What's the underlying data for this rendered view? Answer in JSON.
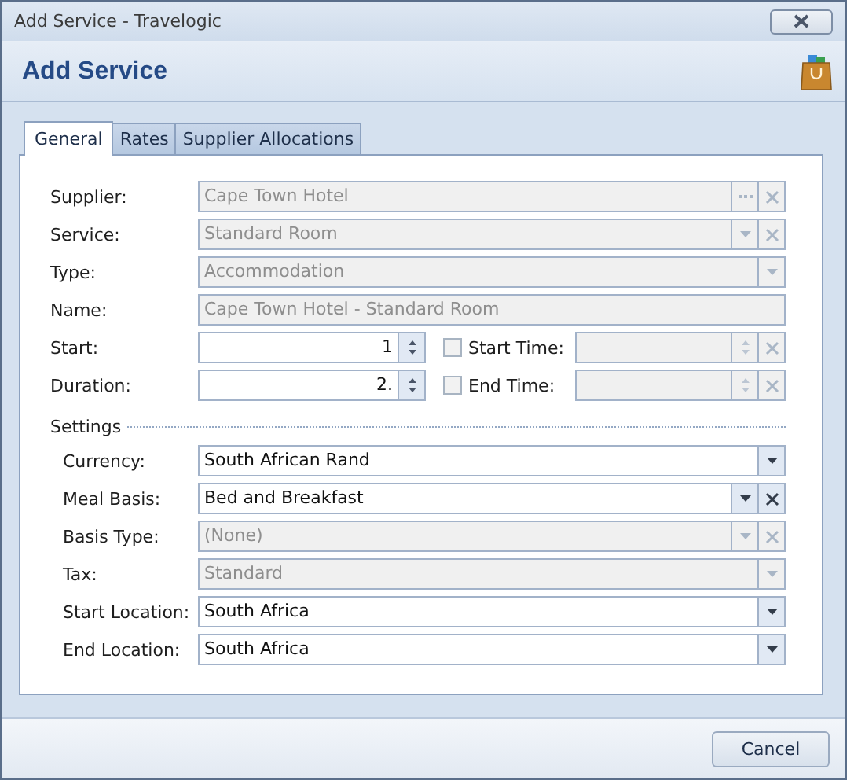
{
  "window": {
    "title": "Add Service - Travelogic"
  },
  "header": {
    "title": "Add Service"
  },
  "tabs": [
    {
      "label": "General",
      "selected": true
    },
    {
      "label": "Rates",
      "selected": false
    },
    {
      "label": "Supplier Allocations",
      "selected": false
    }
  ],
  "general_fields": [
    {
      "label": "Supplier:",
      "value": "Cape Town Hotel",
      "disabled": true,
      "ellipsis": true,
      "clear": true
    },
    {
      "label": "Service:",
      "value": "Standard Room",
      "disabled": true,
      "dropdown": true,
      "clear": true
    },
    {
      "label": "Type:",
      "value": "Accommodation",
      "disabled": true,
      "dropdown": true
    },
    {
      "label": "Name:",
      "value": "Cape Town Hotel  - Standard Room",
      "disabled": true
    }
  ],
  "schedule": [
    {
      "label": "Start:",
      "value": "1",
      "time_label": "Start Time:",
      "time_checked": false
    },
    {
      "label": "Duration:",
      "value": "2.",
      "time_label": "End Time:",
      "time_checked": false
    }
  ],
  "settings": {
    "title": "Settings",
    "fields": [
      {
        "label": "Currency:",
        "value": "South African Rand",
        "disabled": false,
        "dropdown": true
      },
      {
        "label": "Meal Basis:",
        "value": "Bed and Breakfast",
        "disabled": false,
        "dropdown": true,
        "clear": true
      },
      {
        "label": "Basis Type:",
        "value": "(None)",
        "disabled": true,
        "dropdown": true,
        "clear": true
      },
      {
        "label": "Tax:",
        "value": "Standard",
        "disabled": true,
        "dropdown": true
      },
      {
        "label": "Start Location:",
        "value": "South Africa",
        "disabled": false,
        "dropdown": true
      },
      {
        "label": "End Location:",
        "value": "South Africa",
        "disabled": false,
        "dropdown": true
      }
    ]
  },
  "buttons": [
    {
      "label": "Cancel"
    }
  ]
}
